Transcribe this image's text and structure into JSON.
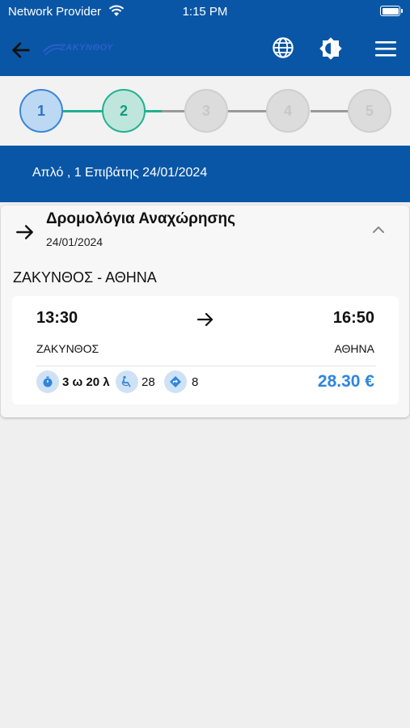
{
  "status_bar": {
    "carrier": "Network Provider",
    "time": "1:15 PM"
  },
  "app_bar": {
    "logo_text": "ΖΑΚΥΝΘΟΥ",
    "icons": [
      "back-arrow-icon",
      "globe-icon",
      "brightness-icon",
      "menu-icon"
    ]
  },
  "stepper": {
    "steps": [
      "1",
      "2",
      "3",
      "4",
      "5"
    ],
    "current_step": 2,
    "colors": {
      "done": "#3a86d6",
      "current": "#22b090",
      "todo": "#c7c7c7"
    }
  },
  "summary": {
    "text": "Απλό , 1 Επιβάτης  24/01/2024"
  },
  "departures": {
    "title": "Δρομολόγια Αναχώρησης",
    "date": "24/01/2024",
    "route": "ΖΑΚΥΝΘΟΣ - ΑΘΗΝΑ",
    "trips": [
      {
        "departure_time": "13:30",
        "arrival_time": "16:50",
        "from": "ΖΑΚΥΝΘΟΣ",
        "to": "ΑΘΗΝΑ",
        "duration": "3 ω 20 λ",
        "seats": "28",
        "stops": "8",
        "price": "28.30 €"
      }
    ]
  },
  "colors": {
    "brand": "#0a56a6",
    "price": "#2e86de",
    "background": "#efefef"
  }
}
